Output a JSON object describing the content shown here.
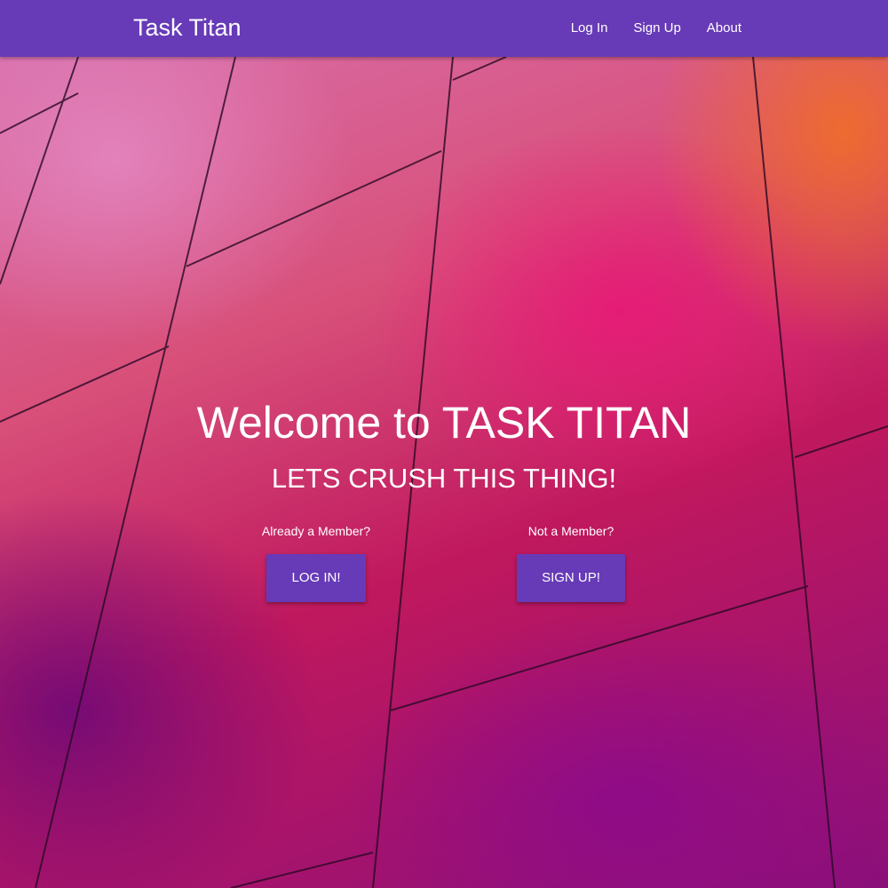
{
  "navbar": {
    "brand": "Task Titan",
    "links": [
      "Log In",
      "Sign Up",
      "About"
    ],
    "color": "#673ab7"
  },
  "hero": {
    "title": "Welcome to TASK TITAN",
    "subtitle": "LETS CRUSH THIS THING!"
  },
  "login": {
    "prompt": "Already a Member?",
    "button": "LOG IN!"
  },
  "signup": {
    "prompt": "Not a Member?",
    "button": "SIGN UP!"
  }
}
